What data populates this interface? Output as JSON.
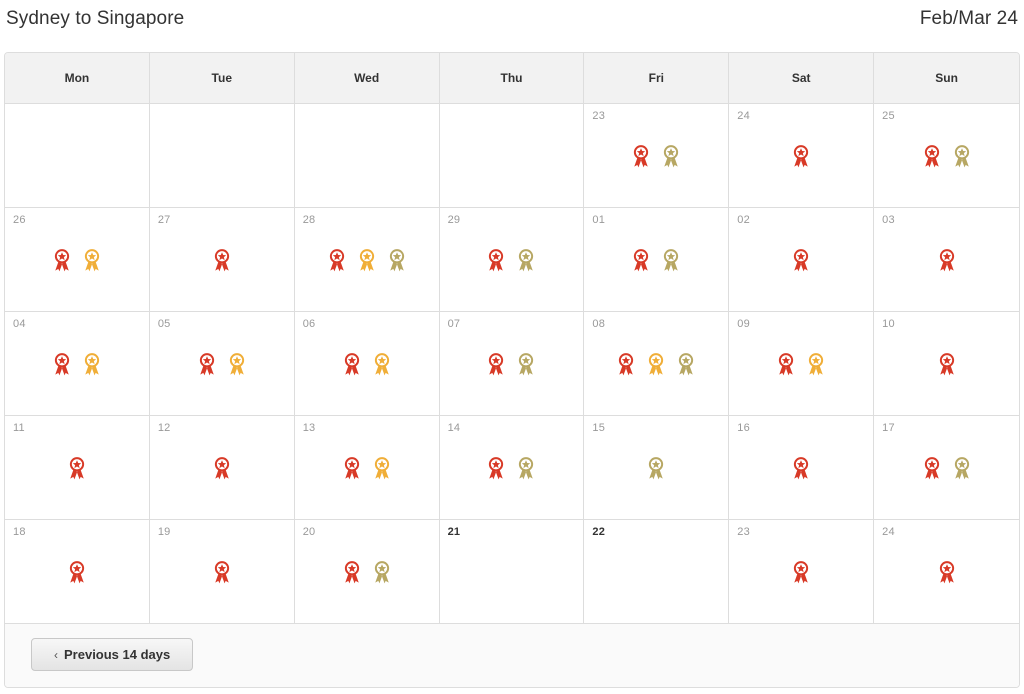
{
  "header": {
    "route_title": "Sydney to Singapore",
    "period_label": "Feb/Mar 24"
  },
  "calendar": {
    "weekdays": [
      "Mon",
      "Tue",
      "Wed",
      "Thu",
      "Fri",
      "Sat",
      "Sun"
    ],
    "award_colors": {
      "red": "#d83a27",
      "gold": "#f0ae38",
      "tan": "#b7a763"
    },
    "icon_name": "award-ribbon-icon",
    "weeks": [
      {
        "days": [
          {
            "label": "",
            "empty": true,
            "highlighted": false,
            "awards": []
          },
          {
            "label": "",
            "empty": true,
            "highlighted": false,
            "awards": []
          },
          {
            "label": "",
            "empty": true,
            "highlighted": false,
            "awards": []
          },
          {
            "label": "",
            "empty": true,
            "highlighted": false,
            "awards": []
          },
          {
            "label": "23",
            "empty": false,
            "highlighted": false,
            "awards": [
              "red",
              "tan"
            ]
          },
          {
            "label": "24",
            "empty": false,
            "highlighted": false,
            "awards": [
              "red"
            ]
          },
          {
            "label": "25",
            "empty": false,
            "highlighted": false,
            "awards": [
              "red",
              "tan"
            ]
          }
        ]
      },
      {
        "days": [
          {
            "label": "26",
            "empty": false,
            "highlighted": false,
            "awards": [
              "red",
              "gold"
            ]
          },
          {
            "label": "27",
            "empty": false,
            "highlighted": false,
            "awards": [
              "red"
            ]
          },
          {
            "label": "28",
            "empty": false,
            "highlighted": false,
            "awards": [
              "red",
              "gold",
              "tan"
            ]
          },
          {
            "label": "29",
            "empty": false,
            "highlighted": false,
            "awards": [
              "red",
              "tan"
            ]
          },
          {
            "label": "01",
            "empty": false,
            "highlighted": false,
            "awards": [
              "red",
              "tan"
            ]
          },
          {
            "label": "02",
            "empty": false,
            "highlighted": false,
            "awards": [
              "red"
            ]
          },
          {
            "label": "03",
            "empty": false,
            "highlighted": false,
            "awards": [
              "red"
            ]
          }
        ]
      },
      {
        "days": [
          {
            "label": "04",
            "empty": false,
            "highlighted": false,
            "awards": [
              "red",
              "gold"
            ]
          },
          {
            "label": "05",
            "empty": false,
            "highlighted": false,
            "awards": [
              "red",
              "gold"
            ]
          },
          {
            "label": "06",
            "empty": false,
            "highlighted": false,
            "awards": [
              "red",
              "gold"
            ]
          },
          {
            "label": "07",
            "empty": false,
            "highlighted": false,
            "awards": [
              "red",
              "tan"
            ]
          },
          {
            "label": "08",
            "empty": false,
            "highlighted": false,
            "awards": [
              "red",
              "gold",
              "tan"
            ]
          },
          {
            "label": "09",
            "empty": false,
            "highlighted": false,
            "awards": [
              "red",
              "gold"
            ]
          },
          {
            "label": "10",
            "empty": false,
            "highlighted": false,
            "awards": [
              "red"
            ]
          }
        ]
      },
      {
        "days": [
          {
            "label": "11",
            "empty": false,
            "highlighted": false,
            "awards": [
              "red"
            ]
          },
          {
            "label": "12",
            "empty": false,
            "highlighted": false,
            "awards": [
              "red"
            ]
          },
          {
            "label": "13",
            "empty": false,
            "highlighted": false,
            "awards": [
              "red",
              "gold"
            ]
          },
          {
            "label": "14",
            "empty": false,
            "highlighted": false,
            "awards": [
              "red",
              "tan"
            ]
          },
          {
            "label": "15",
            "empty": false,
            "highlighted": false,
            "awards": [
              "tan"
            ]
          },
          {
            "label": "16",
            "empty": false,
            "highlighted": false,
            "awards": [
              "red"
            ]
          },
          {
            "label": "17",
            "empty": false,
            "highlighted": false,
            "awards": [
              "red",
              "tan"
            ]
          }
        ]
      },
      {
        "days": [
          {
            "label": "18",
            "empty": false,
            "highlighted": false,
            "awards": [
              "red"
            ]
          },
          {
            "label": "19",
            "empty": false,
            "highlighted": false,
            "awards": [
              "red"
            ]
          },
          {
            "label": "20",
            "empty": false,
            "highlighted": false,
            "awards": [
              "red",
              "tan"
            ]
          },
          {
            "label": "21",
            "empty": false,
            "highlighted": true,
            "awards": []
          },
          {
            "label": "22",
            "empty": false,
            "highlighted": true,
            "awards": []
          },
          {
            "label": "23",
            "empty": false,
            "highlighted": false,
            "awards": [
              "red"
            ]
          },
          {
            "label": "24",
            "empty": false,
            "highlighted": false,
            "awards": [
              "red"
            ]
          }
        ]
      }
    ],
    "footer": {
      "prev_button_label": "Previous 14 days",
      "prev_button_chevron": "‹"
    }
  }
}
